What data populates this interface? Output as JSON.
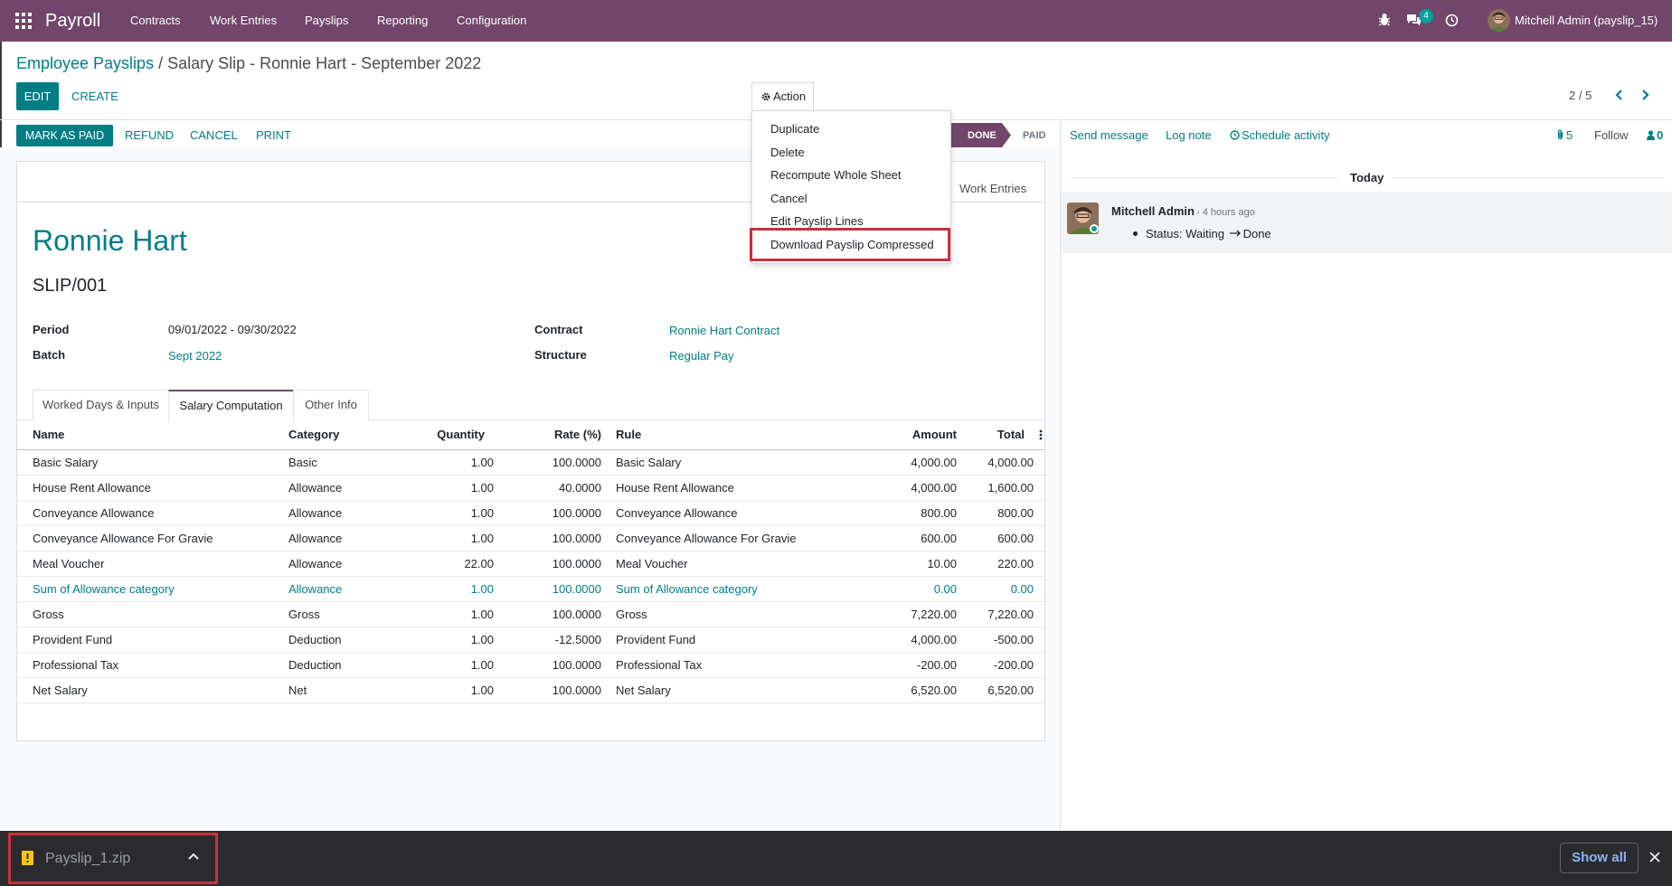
{
  "navbar": {
    "brand": "Payroll",
    "menu": [
      "Contracts",
      "Work Entries",
      "Payslips",
      "Reporting",
      "Configuration"
    ],
    "message_count": "4",
    "user": "Mitchell Admin (payslip_15)"
  },
  "breadcrumb": {
    "parent": "Employee Payslips",
    "separator": " / ",
    "current": "Salary Slip - Ronnie Hart - September 2022"
  },
  "control": {
    "edit": "EDIT",
    "create": "CREATE",
    "action": "Action",
    "pager": "2 / 5"
  },
  "statusbar": {
    "mark_as_paid": "MARK AS PAID",
    "refund": "REFUND",
    "cancel": "CANCEL",
    "print": "PRINT",
    "stages": [
      "DONE",
      "PAID"
    ],
    "active_stage": "DONE"
  },
  "action_menu": {
    "items": [
      "Duplicate",
      "Delete",
      "Recompute Whole Sheet",
      "Cancel",
      "Edit Payslip Lines",
      "Download Payslip Compressed"
    ],
    "highlighted": "Download Payslip Compressed"
  },
  "form": {
    "smart_button": "Work Entries",
    "employee": "Ronnie Hart",
    "number": "SLIP/001",
    "fields": {
      "period_label": "Period",
      "period": "09/01/2022 - 09/30/2022",
      "batch_label": "Batch",
      "batch": "Sept 2022",
      "contract_label": "Contract",
      "contract": "Ronnie Hart Contract",
      "structure_label": "Structure",
      "structure": "Regular Pay"
    },
    "tabs": [
      "Worked Days & Inputs",
      "Salary Computation",
      "Other Info"
    ],
    "active_tab": "Salary Computation"
  },
  "table": {
    "columns": [
      "Name",
      "Category",
      "Quantity",
      "Rate (%)",
      "Rule",
      "Amount",
      "Total"
    ],
    "rows": [
      [
        "Basic Salary",
        "Basic",
        "1.00",
        "100.0000",
        "Basic Salary",
        "4,000.00",
        "4,000.00"
      ],
      [
        "House Rent Allowance",
        "Allowance",
        "1.00",
        "40.0000",
        "House Rent Allowance",
        "4,000.00",
        "1,600.00"
      ],
      [
        "Conveyance Allowance",
        "Allowance",
        "1.00",
        "100.0000",
        "Conveyance Allowance",
        "800.00",
        "800.00"
      ],
      [
        "Conveyance Allowance For Gravie",
        "Allowance",
        "1.00",
        "100.0000",
        "Conveyance Allowance For Gravie",
        "600.00",
        "600.00"
      ],
      [
        "Meal Voucher",
        "Allowance",
        "22.00",
        "100.0000",
        "Meal Voucher",
        "10.00",
        "220.00"
      ],
      [
        "Sum of Allowance category",
        "Allowance",
        "1.00",
        "100.0000",
        "Sum of Allowance category",
        "0.00",
        "0.00"
      ],
      [
        "Gross",
        "Gross",
        "1.00",
        "100.0000",
        "Gross",
        "7,220.00",
        "7,220.00"
      ],
      [
        "Provident Fund",
        "Deduction",
        "1.00",
        "-12.5000",
        "Provident Fund",
        "4,000.00",
        "-500.00"
      ],
      [
        "Professional Tax",
        "Deduction",
        "1.00",
        "100.0000",
        "Professional Tax",
        "-200.00",
        "-200.00"
      ],
      [
        "Net Salary",
        "Net",
        "1.00",
        "100.0000",
        "Net Salary",
        "6,520.00",
        "6,520.00"
      ]
    ]
  },
  "chatter": {
    "send_message": "Send message",
    "log_note": "Log note",
    "schedule_activity": "Schedule activity",
    "attachments": "5",
    "follow": "Follow",
    "followers": "0",
    "date_separator": "Today",
    "author": "Mitchell Admin",
    "time": "- 4 hours ago",
    "tracking": "Status: Waiting",
    "tracking_new": "Done"
  },
  "download_bar": {
    "file": "Payslip_1.zip",
    "show_all": "Show all"
  },
  "colors": {
    "brand": "#71466a",
    "primary": "#017e84",
    "highlight_border": "#c7303b"
  }
}
